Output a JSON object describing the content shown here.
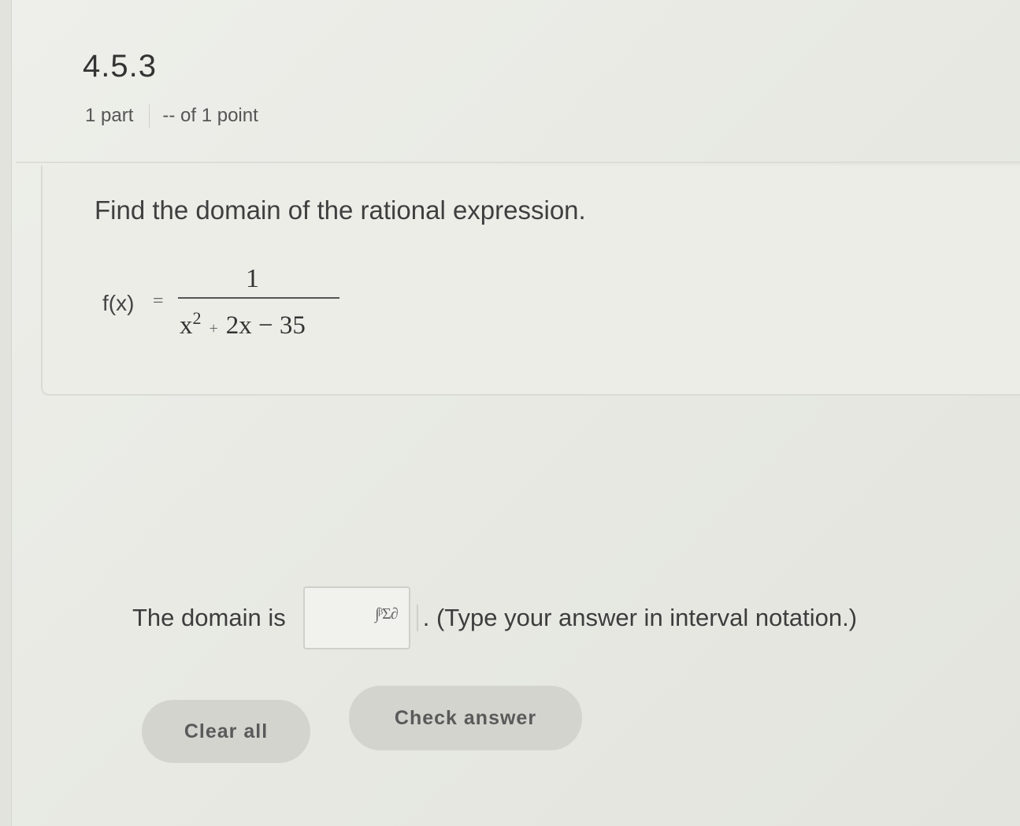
{
  "question": {
    "number": "4.5.3",
    "parts": "1 part",
    "points": "-- of 1 point",
    "prompt": "Find the domain of the rational expression.",
    "formula": {
      "lhs": "f(x)",
      "equals": "=",
      "numerator": "1",
      "denominator_base": "x",
      "denominator_exponent": "2",
      "denominator_plus": "+",
      "denominator_rest": "2x − 35"
    }
  },
  "answer": {
    "label": "The domain is",
    "input_value": "",
    "math_icon": "∫ᵝΣ∂",
    "instruction": ". (Type your answer in interval notation.)"
  },
  "buttons": {
    "clear": "Clear all",
    "check": "Check answer"
  }
}
